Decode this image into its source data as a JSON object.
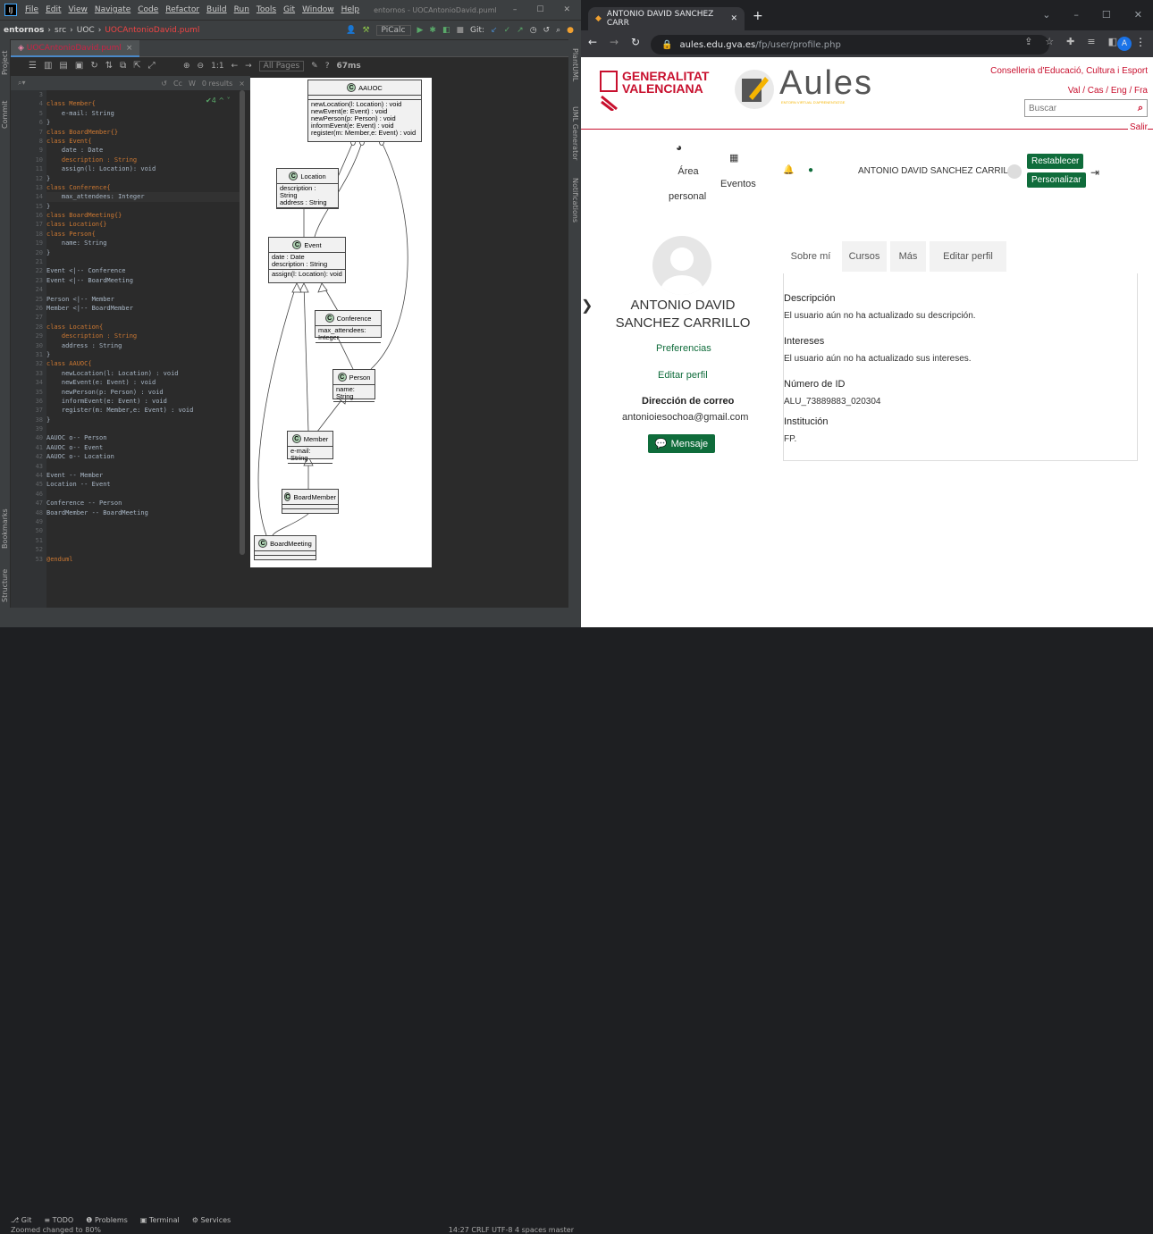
{
  "ide": {
    "menu": [
      "File",
      "Edit",
      "View",
      "Navigate",
      "Code",
      "Refactor",
      "Build",
      "Run",
      "Tools",
      "Git",
      "Window",
      "Help"
    ],
    "window_title": "entornos - UOCAntonioDavid.puml",
    "breadcrumb": {
      "project": "entornos",
      "folder": "src",
      "sub": "UOC",
      "file": "UOCAntonioDavid.puml"
    },
    "run_config": "PiCalc",
    "git_label": "Git:",
    "tab_file": "UOCAntonioDavid.puml",
    "left_strip": [
      "Project",
      "Commit",
      "Bookmarks",
      "Structure"
    ],
    "right_strip": [
      "PlantUML",
      "UML Generator",
      "Notifications"
    ],
    "preview_toolbar": {
      "zoom": "1:1",
      "pages": "All Pages",
      "time": "67ms"
    },
    "find": {
      "results": "0 results",
      "case": "Cc",
      "word": "W"
    },
    "warnings": "4",
    "code_lines": [
      {
        "n": "3",
        "t": ""
      },
      {
        "n": "4",
        "t": "class Member{"
      },
      {
        "n": "5",
        "t": "    e-mail: String"
      },
      {
        "n": "6",
        "t": "}"
      },
      {
        "n": "7",
        "t": "class BoardMember{}"
      },
      {
        "n": "8",
        "t": "class Event{"
      },
      {
        "n": "9",
        "t": "    date : Date"
      },
      {
        "n": "10",
        "t": "    description : String"
      },
      {
        "n": "11",
        "t": "    assign(l: Location): void"
      },
      {
        "n": "12",
        "t": "}"
      },
      {
        "n": "13",
        "t": "class Conference{"
      },
      {
        "n": "14",
        "t": "    max_attendees: Integer"
      },
      {
        "n": "15",
        "t": "}"
      },
      {
        "n": "16",
        "t": "class BoardMeeting{}"
      },
      {
        "n": "17",
        "t": "class Location{}"
      },
      {
        "n": "18",
        "t": "class Person{"
      },
      {
        "n": "19",
        "t": "    name: String"
      },
      {
        "n": "20",
        "t": "}"
      },
      {
        "n": "21",
        "t": ""
      },
      {
        "n": "22",
        "t": "Event <|-- Conference"
      },
      {
        "n": "23",
        "t": "Event <|-- BoardMeeting"
      },
      {
        "n": "24",
        "t": ""
      },
      {
        "n": "25",
        "t": "Person <|-- Member"
      },
      {
        "n": "26",
        "t": "Member <|-- BoardMember"
      },
      {
        "n": "27",
        "t": ""
      },
      {
        "n": "28",
        "t": "class Location{"
      },
      {
        "n": "29",
        "t": "    description : String"
      },
      {
        "n": "30",
        "t": "    address : String"
      },
      {
        "n": "31",
        "t": "}"
      },
      {
        "n": "32",
        "t": "class AAUOC{"
      },
      {
        "n": "33",
        "t": "    newLocation(l: Location) : void"
      },
      {
        "n": "34",
        "t": "    newEvent(e: Event) : void"
      },
      {
        "n": "35",
        "t": "    newPerson(p: Person) : void"
      },
      {
        "n": "36",
        "t": "    informEvent(e: Event) : void"
      },
      {
        "n": "37",
        "t": "    register(m: Member,e: Event) : void"
      },
      {
        "n": "38",
        "t": "}"
      },
      {
        "n": "39",
        "t": ""
      },
      {
        "n": "40",
        "t": "AAUOC o-- Person"
      },
      {
        "n": "41",
        "t": "AAUOC o-- Event"
      },
      {
        "n": "42",
        "t": "AAUOC o-- Location"
      },
      {
        "n": "43",
        "t": ""
      },
      {
        "n": "44",
        "t": "Event -- Member"
      },
      {
        "n": "45",
        "t": "Location -- Event"
      },
      {
        "n": "46",
        "t": ""
      },
      {
        "n": "47",
        "t": "Conference -- Person"
      },
      {
        "n": "48",
        "t": "BoardMember -- BoardMeeting"
      },
      {
        "n": "49",
        "t": ""
      },
      {
        "n": "50",
        "t": ""
      },
      {
        "n": "51",
        "t": ""
      },
      {
        "n": "52",
        "t": ""
      },
      {
        "n": "53",
        "t": "@enduml"
      }
    ],
    "uml": {
      "aauoc": {
        "name": "AAUOC",
        "methods": [
          "newLocation(l: Location) : void",
          "newEvent(e: Event) : void",
          "newPerson(p: Person) : void",
          "informEvent(e: Event) : void",
          "register(m: Member,e: Event) : void"
        ]
      },
      "location": {
        "name": "Location",
        "fields": [
          "description : String",
          "address : String"
        ]
      },
      "event": {
        "name": "Event",
        "fields": [
          "date : Date",
          "description : String"
        ],
        "methods": [
          "assign(l: Location): void"
        ]
      },
      "conference": {
        "name": "Conference",
        "fields": [
          "max_attendees: Integer"
        ]
      },
      "person": {
        "name": "Person",
        "fields": [
          "name: String"
        ]
      },
      "member": {
        "name": "Member",
        "fields": [
          "e-mail: String"
        ]
      },
      "boardmember": {
        "name": "BoardMember"
      },
      "boardmeeting": {
        "name": "BoardMeeting"
      },
      "stereotype": "C"
    },
    "bottom_tools": [
      "Git",
      "TODO",
      "Problems",
      "Terminal",
      "Services"
    ],
    "status_msg": "Zoomed changed to 80%",
    "status_right": "14:27  CRLF  UTF-8  4 spaces  master"
  },
  "browser": {
    "tab_title": "ANTONIO DAVID SANCHEZ CARR",
    "url_host": "aules.edu.gva.es",
    "url_path": "/fp/user/profile.php",
    "avatar_letter": "A",
    "page": {
      "gv_line1": "GENERALITAT",
      "gv_line2": "VALENCIANA",
      "aules": "Aules",
      "aules_sub": "ENTORN VIRTUAL D'APRENENTATGE",
      "conselleria": "Conselleria d'Educació, Cultura i Esport",
      "langs": "Val / Cas / Eng / Fra",
      "search_placeholder": "Buscar",
      "salir": "Salir",
      "nav_area_1": "Área",
      "nav_area_2": "personal",
      "nav_eventos": "Eventos",
      "user_name_nav": "ANTONIO DAVID SANCHEZ CARRILLO",
      "btn_restablecer": "Restablecer",
      "btn_personalizar": "Personalizar",
      "profile_name": "ANTONIO DAVID SANCHEZ CARRILLO",
      "preferencias": "Preferencias",
      "editar_perfil_link": "Editar perfil",
      "email_label": "Dirección de correo",
      "email": "antonioiesochoa@gmail.com",
      "mensaje": "Mensaje",
      "tabs": [
        "Sobre mí",
        "Cursos",
        "Más",
        "Editar perfil"
      ],
      "descripcion_label": "Descripción",
      "descripcion_value": "El usuario aún no ha actualizado su descripción.",
      "intereses_label": "Intereses",
      "intereses_value": "El usuario aún no ha actualizado sus intereses.",
      "id_label": "Número de ID",
      "id_value": "ALU_73889883_020304",
      "inst_label": "Institución",
      "inst_value": "FP."
    }
  },
  "colors": {
    "brand_red": "#c8102e",
    "aules_green": "#0f6c3b",
    "ide_bg": "#2b2b2b"
  }
}
